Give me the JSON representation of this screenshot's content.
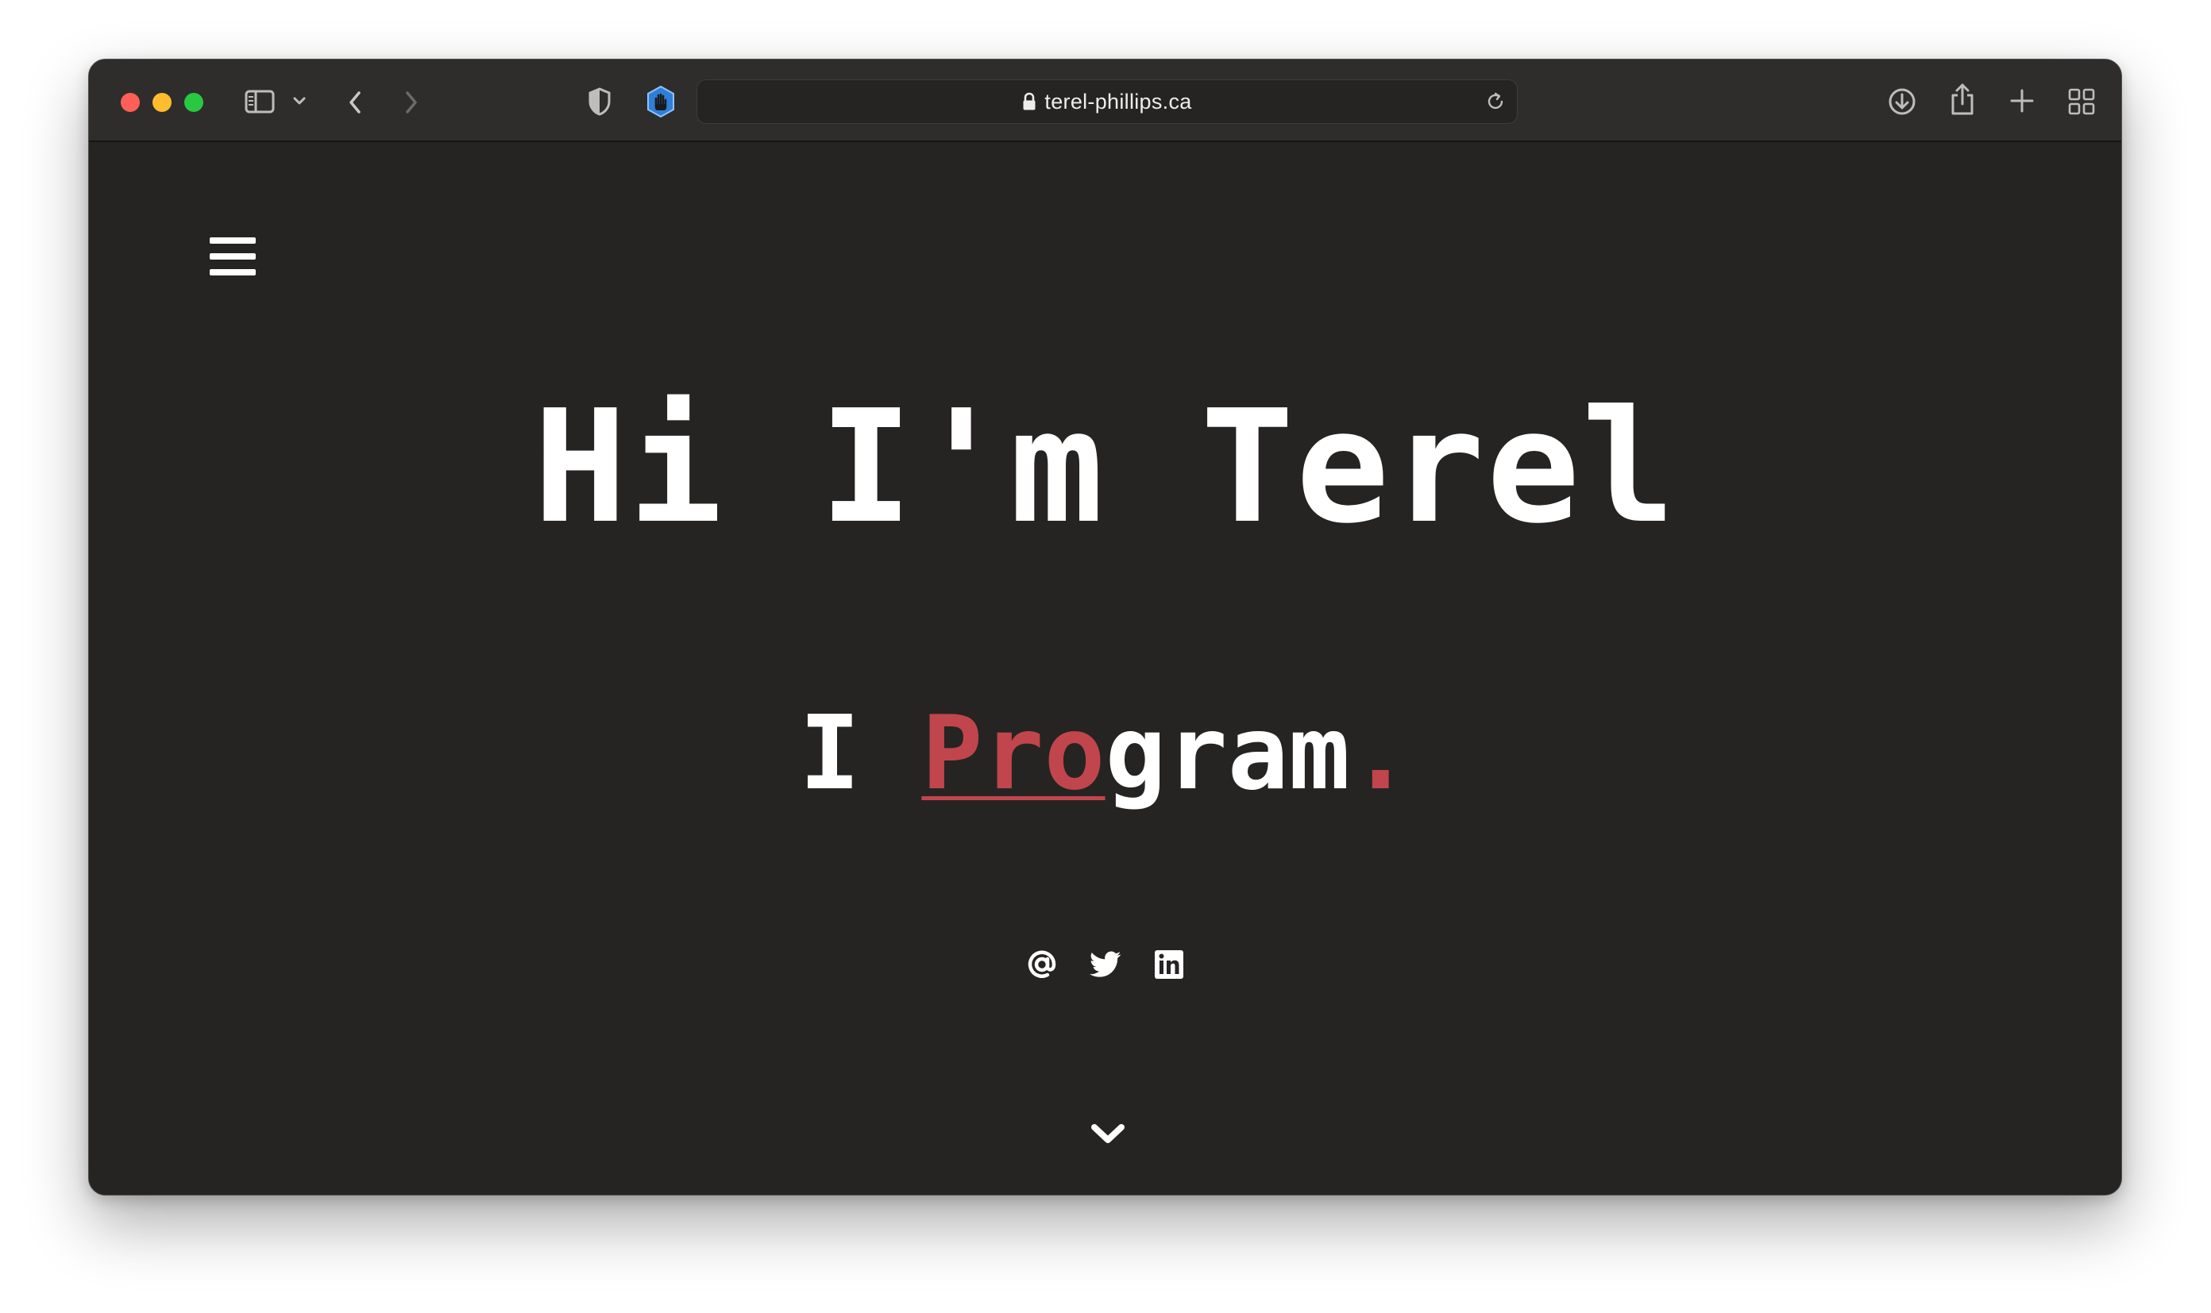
{
  "browser": {
    "url": "terel-phillips.ca",
    "icons": {
      "sidebar": "sidebar-icon",
      "sidebar_menu": "chevron-down-icon",
      "back": "chevron-left-icon",
      "forward": "chevron-right-icon",
      "privacy": "shield-icon",
      "extension": "hand-stop-icon",
      "lock": "lock-icon",
      "reload": "reload-icon",
      "downloads": "download-icon",
      "share": "share-icon",
      "new_tab": "plus-icon",
      "tab_overview": "grid-icon"
    }
  },
  "page": {
    "menu_icon": "hamburger-icon",
    "hero": {
      "greeting": "Hi I'm Terel",
      "prefix": "I ",
      "typed": "Pro",
      "rest": "gram",
      "punct": "."
    },
    "socials": [
      {
        "name": "email",
        "icon": "at-sign-icon"
      },
      {
        "name": "twitter",
        "icon": "twitter-icon"
      },
      {
        "name": "linkedin",
        "icon": "linkedin-icon"
      }
    ],
    "scroll_icon": "chevron-down-icon"
  },
  "colors": {
    "background": "#252423",
    "toolbar": "#2e2d2c",
    "accent": "#c1454c",
    "text": "#ffffff"
  }
}
